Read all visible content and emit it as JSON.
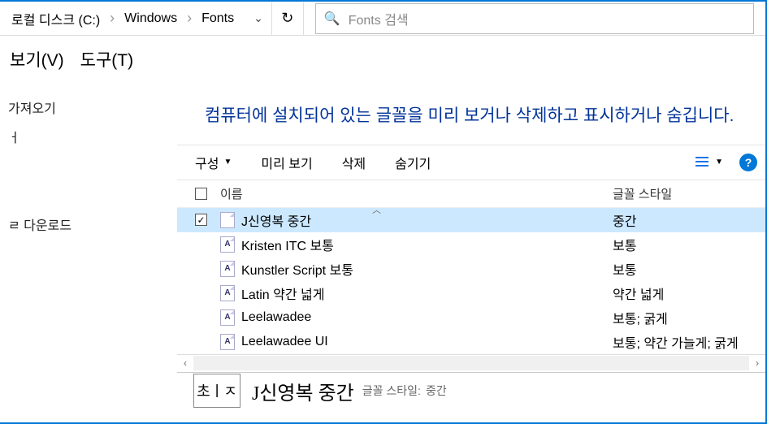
{
  "breadcrumb": {
    "parts": [
      "로컬 디스크 (C:)",
      "Windows",
      "Fonts"
    ]
  },
  "search": {
    "placeholder": "Fonts 검색"
  },
  "menu": {
    "view": "보기(V)",
    "tools": "도구(T)"
  },
  "sidebar": {
    "link1": "가져오기",
    "linkx": "ㅓ",
    "link2": "ㄹ 다운로드"
  },
  "heading": "컴퓨터에 설치되어 있는 글꼴을 미리 보거나 삭제하고 표시하거나 숨깁니다.",
  "toolbar": {
    "organize": "구성",
    "preview": "미리 보기",
    "delete": "삭제",
    "hide": "숨기기"
  },
  "columns": {
    "name": "이름",
    "style": "글꼴 스타일"
  },
  "rows": [
    {
      "name": "J신영복 중간",
      "style": "중간",
      "selected": true,
      "glyph": ""
    },
    {
      "name": "Kristen ITC 보통",
      "style": "보통",
      "selected": false,
      "glyph": "A"
    },
    {
      "name": "Kunstler Script 보통",
      "style": "보통",
      "selected": false,
      "glyph": "A"
    },
    {
      "name": "Latin 약간 넓게",
      "style": "약간 넓게",
      "selected": false,
      "glyph": "A"
    },
    {
      "name": "Leelawadee",
      "style": "보통; 굵게",
      "selected": false,
      "glyph": "A"
    },
    {
      "name": "Leelawadee UI",
      "style": "보통; 약간 가늘게; 굵게",
      "selected": false,
      "glyph": "A"
    }
  ],
  "preview": {
    "thumb": "초ㅣㅈ",
    "name": "J신영복 중간",
    "style_label": "글꼴 스타일:",
    "style_value": "중간"
  }
}
